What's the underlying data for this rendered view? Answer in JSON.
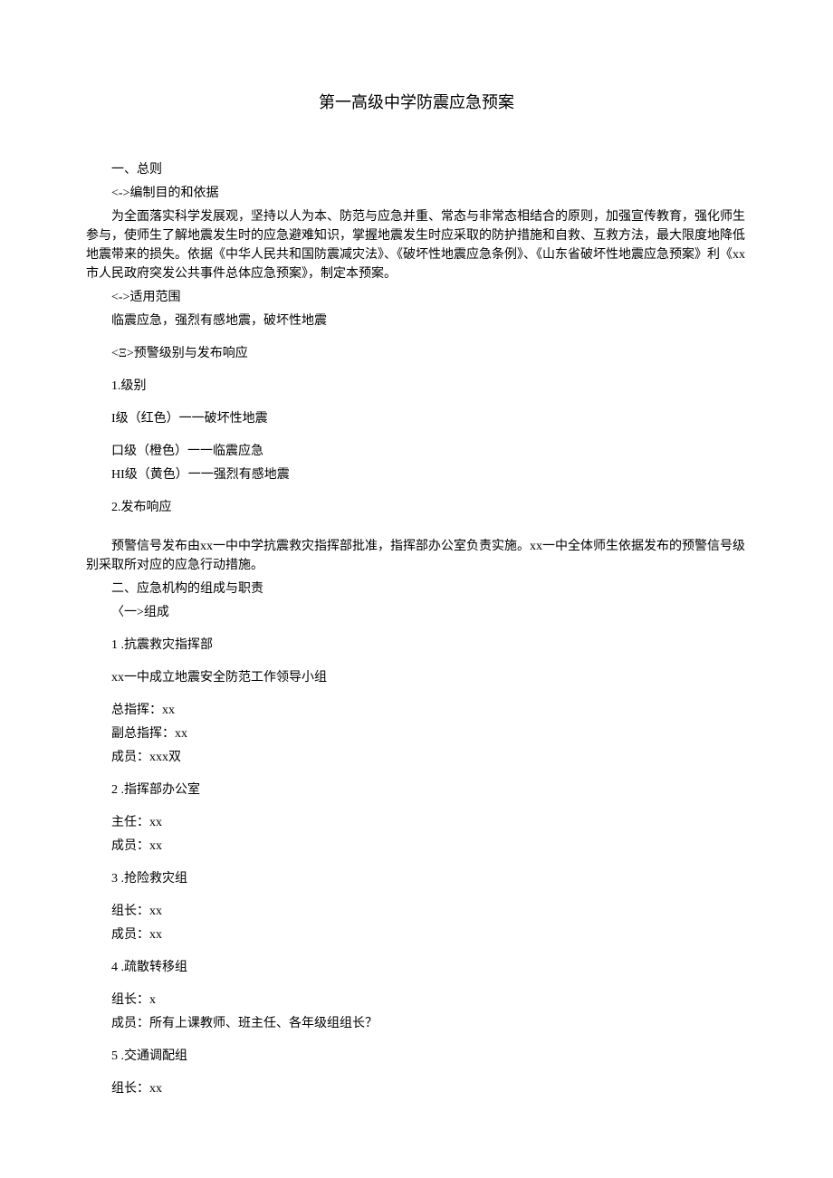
{
  "title": "第一高级中学防震应急预案",
  "s1": {
    "h": "一、总则",
    "sub1": "<->编制目的和依据",
    "para1": "为全面落实科学发展观，坚持以人为本、防范与应急并重、常态与非常态相结合的原则，加强宣传教育，强化师生参与，使师生了解地震发生时的应急避难知识，掌握地震发生时应采取的防护措施和自救、互救方法，最大限度地降低地震带来的损失。依据《中华人民共和国防震减灾法》、《破坏性地震应急条例》、《山东省破坏性地震应急预案》利《xx市人民政府突发公共事件总体应急预案》，制定本预案。",
    "sub2": "<->适用范围",
    "para2": "临震应急，强烈有感地震，破坏性地震",
    "sub3": "<Ξ>预警级别与发布响应",
    "lvlHeading": "1.级别",
    "lvl1": "I级（红色）一一破坏性地震",
    "lvl2": "口级（橙色）一一临震应急",
    "lvl3": "HI级（黄色）一一强烈有感地震",
    "respHeading": "2.发布响应",
    "respPara": "预警信号发布由xx一中中学抗震救灾指挥部批准，指挥部办公室负责实施。xx一中全体师生依据发布的预警信号级别采取所对应的应急行动措施。"
  },
  "s2": {
    "h": "二、应急机构的组成与职责",
    "subA": "〈一>组成",
    "group1": {
      "title": "1  .抗震救灾指挥部",
      "desc": "xx一中成立地震安全防范工作领导小组",
      "p1": "总指挥：xx",
      "p2": "副总指挥：xx",
      "p3": "成员：xxx双"
    },
    "group2": {
      "title": "2  .指挥部办公室",
      "p1": "主任：xx",
      "p2": "成员：xx"
    },
    "group3": {
      "title": "3  .抢险救灾组",
      "p1": "组长：xx",
      "p2": "成员：xx"
    },
    "group4": {
      "title": "4  .疏散转移组",
      "p1": "组长：x",
      "p2": "成员：所有上课教师、班主任、各年级组组长？"
    },
    "group5": {
      "title": "5  .交通调配组",
      "p1": "组长：xx"
    }
  }
}
